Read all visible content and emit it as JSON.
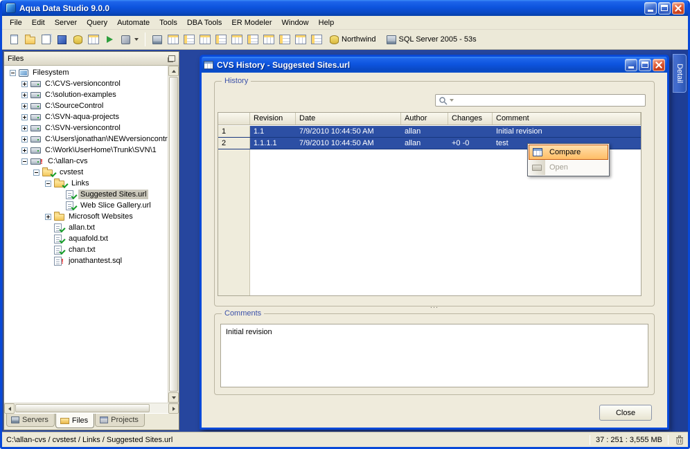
{
  "window": {
    "title": "Aqua Data Studio 9.0.0"
  },
  "menu": {
    "items": [
      "File",
      "Edit",
      "Server",
      "Query",
      "Automate",
      "Tools",
      "DBA Tools",
      "ER Modeler",
      "Window",
      "Help"
    ]
  },
  "toolbar": {
    "connection": {
      "database": "Northwind",
      "server": "SQL Server 2005 - 53s"
    }
  },
  "files_panel": {
    "title": "Files",
    "tree": [
      {
        "label": "Filesystem"
      },
      {
        "label": "C:\\CVS-versioncontrol"
      },
      {
        "label": "C:\\solution-examples"
      },
      {
        "label": "C:\\SourceControl"
      },
      {
        "label": "C:\\SVN-aqua-projects"
      },
      {
        "label": "C:\\SVN-versioncontrol"
      },
      {
        "label": "C:\\Users\\jonathan\\NEWversioncontrol"
      },
      {
        "label": "C:\\Work\\UserHome\\Trunk\\SVN\\1"
      },
      {
        "label": "C:\\allan-cvs"
      },
      {
        "label": "cvstest"
      },
      {
        "label": "Links"
      },
      {
        "label": "Suggested Sites.url"
      },
      {
        "label": "Web Slice Gallery.url"
      },
      {
        "label": "Microsoft Websites"
      },
      {
        "label": "allan.txt"
      },
      {
        "label": "aquafold.txt"
      },
      {
        "label": "chan.txt"
      },
      {
        "label": "jonathantest.sql"
      }
    ],
    "tabs": [
      "Servers",
      "Files",
      "Projects"
    ]
  },
  "dialog": {
    "title": "CVS History - Suggested Sites.url",
    "history_label": "History",
    "comments_label": "Comments",
    "comments_text": "Initial revision",
    "close_label": "Close",
    "splitter": "...",
    "table": {
      "columns": [
        "Revision",
        "Date",
        "Author",
        "Changes",
        "Comment"
      ],
      "rows": [
        {
          "num": "1",
          "revision": "1.1",
          "date": "7/9/2010 10:44:50 AM",
          "author": "allan",
          "changes": "",
          "comment": "Initial revision"
        },
        {
          "num": "2",
          "revision": "1.1.1.1",
          "date": "7/9/2010 10:44:50 AM",
          "author": "allan",
          "changes": "+0 -0",
          "comment": "test"
        }
      ]
    }
  },
  "context_menu": {
    "items": [
      {
        "label": "Compare"
      },
      {
        "label": "Open"
      }
    ]
  },
  "detail_tab": {
    "label": "Detail"
  },
  "status_bar": {
    "path": "C:\\allan-cvs / cvstest / Links / Suggested Sites.url",
    "memory": "37 : 251 : 3,555 MB"
  },
  "icons": {
    "error_mark": "!"
  },
  "colors": {
    "titlebar_blue": "#0D54DE",
    "selection_blue": "#2C4FA4",
    "menu_highlight_orange": "#FFBE66",
    "mdi_background": "#26469E"
  }
}
